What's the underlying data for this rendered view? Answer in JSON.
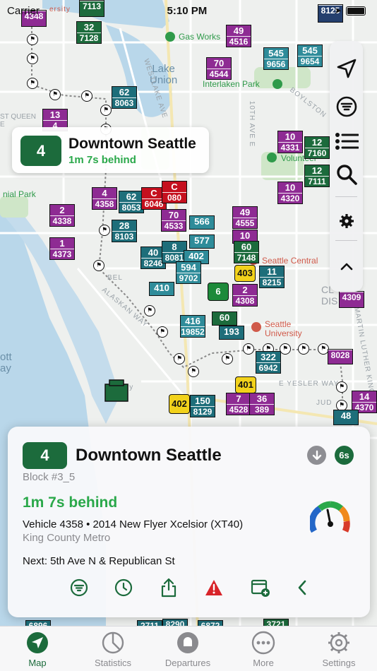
{
  "status_bar": {
    "carrier": "Carrier",
    "time": "5:10 PM"
  },
  "map_labels": {
    "lake": "Lake\nUnion",
    "gas_works": "Gas Works",
    "interlaken": "Interlaken Park",
    "volunteer": "Volunteer",
    "queen_anne": "ST QUEEN\nE",
    "nial_park": "nial Park",
    "seattle_central": "Seattle Central",
    "seattle_university": "Seattle\nUniversity",
    "alaskan_way": "ALASKAN WAY",
    "eyesler": "E YESLER WAY",
    "westlake": "WESTLAKE AVE",
    "tenth": "10TH AVE E",
    "boylston": "BOYLSTON",
    "mlk": "MARTIN LUTHER KING JR",
    "jud": "JUD",
    "dist": "DIS",
    "ott": "ott\nay",
    "ferry": "erry",
    "belltown": "BEL",
    "univ": "ersity",
    "cl": "CL"
  },
  "vehicles": [
    {
      "route": "",
      "vehicle": "7113",
      "color": "green"
    },
    {
      "route": "32",
      "vehicle": "7128",
      "color": "green"
    },
    {
      "route": "",
      "vehicle": "4348",
      "color": "purple"
    },
    {
      "route": "49",
      "vehicle": "4516",
      "color": "purple"
    },
    {
      "route": "545",
      "vehicle": "9656",
      "color": "teal"
    },
    {
      "route": "545",
      "vehicle": "9654",
      "color": "teal"
    },
    {
      "route": "",
      "vehicle": "8125",
      "color": "navy"
    },
    {
      "route": "70",
      "vehicle": "4544",
      "color": "purple"
    },
    {
      "route": "62",
      "vehicle": "8063",
      "color": "darkteal"
    },
    {
      "route": "13",
      "vehicle": "4",
      "color": "purple"
    },
    {
      "route": "10",
      "vehicle": "4331",
      "color": "purple"
    },
    {
      "route": "12",
      "vehicle": "7160",
      "color": "green"
    },
    {
      "route": "12",
      "vehicle": "7111",
      "color": "green"
    },
    {
      "route": "10",
      "vehicle": "4320",
      "color": "purple"
    },
    {
      "route": "4",
      "vehicle": "4358",
      "color": "purple"
    },
    {
      "route": "62",
      "vehicle": "8053",
      "color": "darkteal"
    },
    {
      "route": "2",
      "vehicle": "4338",
      "color": "purple"
    },
    {
      "route": "70",
      "vehicle": "4533",
      "color": "purple"
    },
    {
      "route": "566",
      "vehicle": "",
      "color": "teal"
    },
    {
      "route": "49",
      "vehicle": "4555",
      "color": "purple"
    },
    {
      "route": "28",
      "vehicle": "8103",
      "color": "darkteal"
    },
    {
      "route": "577",
      "vehicle": "",
      "color": "teal"
    },
    {
      "route": "10",
      "vehicle": "",
      "color": "purple"
    },
    {
      "route": "60",
      "vehicle": "7148",
      "color": "green"
    },
    {
      "route": "1",
      "vehicle": "4373",
      "color": "purple"
    },
    {
      "route": "40",
      "vehicle": "8246",
      "color": "darkteal"
    },
    {
      "route": "8",
      "vehicle": "8081",
      "color": "darkteal"
    },
    {
      "route": "402",
      "vehicle": "",
      "color": "teal"
    },
    {
      "route": "594",
      "vehicle": "9702",
      "color": "teal"
    },
    {
      "route": "403",
      "vehicle": "",
      "color": "yellow"
    },
    {
      "route": "11",
      "vehicle": "8215",
      "color": "darkteal"
    },
    {
      "route": "6",
      "vehicle": "",
      "color": "green2"
    },
    {
      "route": "2",
      "vehicle": "4308",
      "color": "purple"
    },
    {
      "route": "410",
      "vehicle": "",
      "color": "teal"
    },
    {
      "route": "416",
      "vehicle": "19852",
      "color": "teal"
    },
    {
      "route": "60",
      "vehicle": "",
      "color": "green"
    },
    {
      "route": "193",
      "vehicle": "",
      "color": "darkteal"
    },
    {
      "route": "322",
      "vehicle": "6942",
      "color": "darkteal"
    },
    {
      "route": "401",
      "vehicle": "",
      "color": "yellow"
    },
    {
      "route": "402",
      "vehicle": "",
      "color": "yellow"
    },
    {
      "route": "150",
      "vehicle": "8129",
      "color": "darkteal"
    },
    {
      "route": "7",
      "vehicle": "4528",
      "color": "purple"
    },
    {
      "route": "36",
      "vehicle": "389",
      "color": "purple"
    },
    {
      "route": "14",
      "vehicle": "4370",
      "color": "purple"
    },
    {
      "route": "48",
      "vehicle": "",
      "color": "darkteal"
    },
    {
      "route": "",
      "vehicle": "4309",
      "color": "purple"
    },
    {
      "route": "",
      "vehicle": "8028",
      "color": "purple"
    },
    {
      "route": "",
      "vehicle": "8290",
      "color": "darkteal"
    },
    {
      "route": "",
      "vehicle": "6872",
      "color": "darkteal"
    },
    {
      "route": "",
      "vehicle": "3721",
      "color": "green"
    },
    {
      "route": "",
      "vehicle": "6896",
      "color": "darkteal"
    },
    {
      "route": "",
      "vehicle": "2711",
      "color": "darkteal"
    },
    {
      "route": "C",
      "vehicle": "6046",
      "color": "red"
    },
    {
      "route": "C",
      "vehicle": "080",
      "color": "red"
    }
  ],
  "callout": {
    "route": "4",
    "title": "Downtown Seattle",
    "subtitle": "1m 7s behind"
  },
  "toolbar": {
    "items": [
      "location-arrow-icon",
      "filter-icon",
      "list-icon",
      "search-icon",
      "gear-icon",
      "chevron-up-icon"
    ]
  },
  "sheet": {
    "route": "4",
    "title": "Downtown Seattle",
    "block": "Block #3_5",
    "delay": "1m 7s behind",
    "vehicle": "Vehicle 4358 • 2014 New Flyer Xcelsior (XT40)",
    "agency": "King County Metro",
    "next": "Next: 5th Ave N & Republican St",
    "refresh_badge": "6s",
    "accent_color": "#2aa84a",
    "route_color": "#1c6b3c"
  },
  "tabs": [
    {
      "label": "Map",
      "icon": "navigation-icon",
      "active": true
    },
    {
      "label": "Statistics",
      "icon": "pie-chart-icon",
      "active": false
    },
    {
      "label": "Departures",
      "icon": "bell-icon",
      "active": false
    },
    {
      "label": "More",
      "icon": "ellipsis-icon",
      "active": false
    },
    {
      "label": "Settings",
      "icon": "gear-icon",
      "active": false
    }
  ]
}
